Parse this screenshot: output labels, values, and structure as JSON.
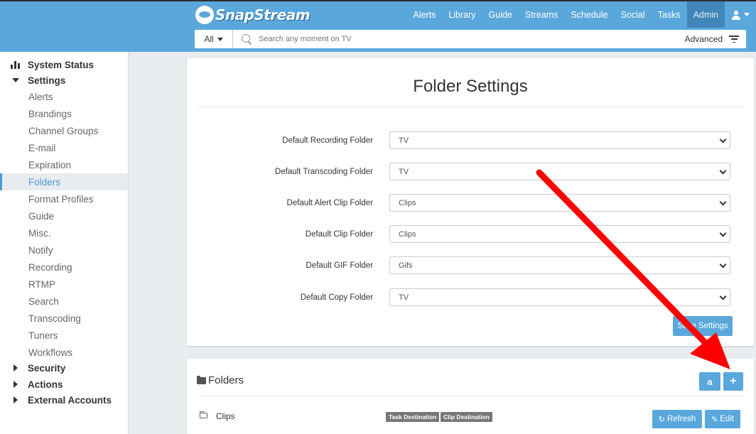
{
  "brand": {
    "name": "SnapStream"
  },
  "nav": {
    "items": [
      {
        "label": "Alerts",
        "active": false
      },
      {
        "label": "Library",
        "active": false
      },
      {
        "label": "Guide",
        "active": false
      },
      {
        "label": "Streams",
        "active": false
      },
      {
        "label": "Schedule",
        "active": false
      },
      {
        "label": "Social",
        "active": false
      },
      {
        "label": "Tasks",
        "active": false
      },
      {
        "label": "Admin",
        "active": true
      }
    ]
  },
  "search": {
    "scope": "All",
    "placeholder": "Search any moment on TV",
    "advanced_label": "Advanced"
  },
  "sidebar": {
    "system_status": "System Status",
    "settings": "Settings",
    "settings_items": [
      "Alerts",
      "Brandings",
      "Channel Groups",
      "E-mail",
      "Expiration",
      "Folders",
      "Format Profiles",
      "Guide",
      "Misc.",
      "Notify",
      "Recording",
      "RTMP",
      "Search",
      "Transcoding",
      "Tuners",
      "Workflows"
    ],
    "active_item": "Folders",
    "security": "Security",
    "actions": "Actions",
    "external_accounts": "External Accounts"
  },
  "folder_settings": {
    "title": "Folder Settings",
    "fields": [
      {
        "label": "Default Recording Folder",
        "value": "TV"
      },
      {
        "label": "Default Transcoding Folder",
        "value": "TV"
      },
      {
        "label": "Default Alert Clip Folder",
        "value": "Clips"
      },
      {
        "label": "Default Clip Folder",
        "value": "Clips"
      },
      {
        "label": "Default GIF Folder",
        "value": "Gifs"
      },
      {
        "label": "Default Copy Folder",
        "value": "TV"
      }
    ],
    "save_label": "Save Settings"
  },
  "folders": {
    "title": "Folders",
    "amazon_label": "a",
    "add_label": "+",
    "rows": [
      {
        "name": "Clips",
        "badges": [
          "Task Destination",
          "Clip Destination"
        ],
        "refresh_label": "Refresh",
        "edit_label": "Edit"
      }
    ]
  },
  "annotation": {
    "arrow_color": "#ff0000"
  },
  "colors": {
    "header": "#5aa7dc",
    "admin_active": "#4185b9",
    "button": "#5aa7dc",
    "sidebar_active": "#4a9bd4"
  }
}
